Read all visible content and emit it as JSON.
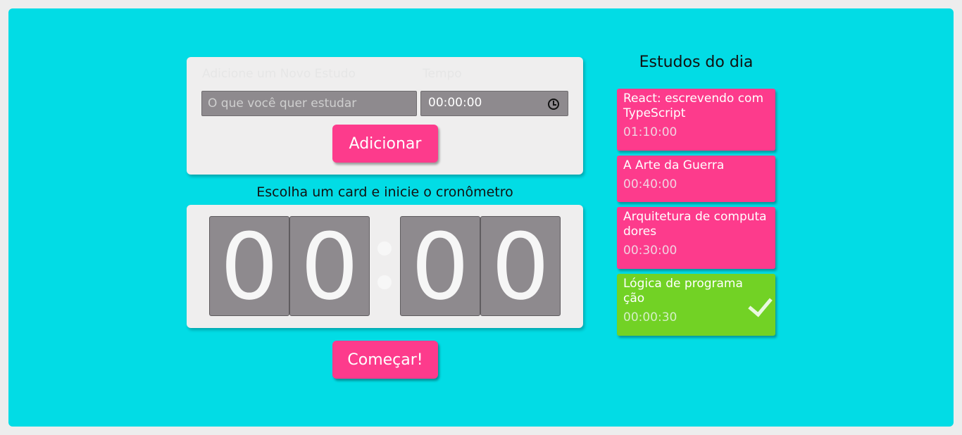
{
  "form": {
    "subject_label": "Adicione um Novo Estudo",
    "time_label": "Tempo",
    "subject_placeholder": "O que você quer estudar",
    "time_value": "00:00:00",
    "add_button": "Adicionar"
  },
  "timer": {
    "heading": "Escolha um card e inicie o cronômetro",
    "digits": [
      "0",
      "0",
      "0",
      "0"
    ],
    "start_button": "Começar!"
  },
  "list": {
    "title": "Estudos do dia",
    "items": [
      {
        "name": "React: escrevendo com TypeScript",
        "time": "01:10:00",
        "completed": false
      },
      {
        "name": "A Arte da Guerra",
        "time": "00:40:00",
        "completed": false
      },
      {
        "name": "Arquitetura de computadores",
        "time": "00:30:00",
        "completed": false
      },
      {
        "name": "Lógica de programação",
        "time": "00:00:30",
        "completed": true
      }
    ]
  },
  "icons": {
    "time_input": "clock-icon",
    "completed": "check-icon"
  },
  "colors": {
    "background": "#02dce5",
    "accent": "#fd3b8c",
    "completed": "#72d225",
    "panel": "#efeeee",
    "digit": "#8e8a8e"
  }
}
